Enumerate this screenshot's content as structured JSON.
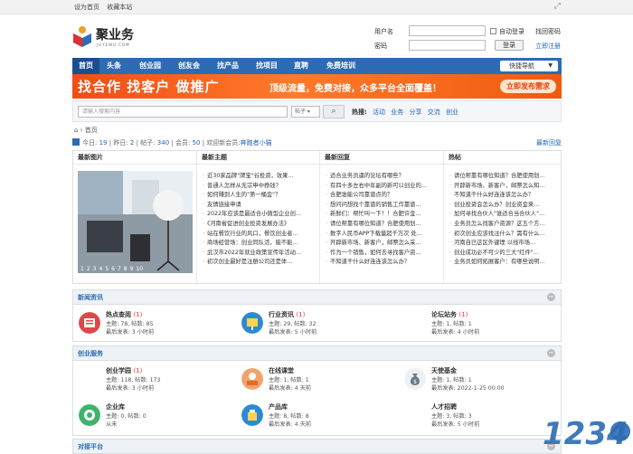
{
  "topbar": {
    "set_home": "设为首页",
    "bookmark": "收藏本站"
  },
  "logo": {
    "name": "聚业务",
    "sub": "JUYEWU.COM"
  },
  "login": {
    "username_label": "用户名",
    "password_label": "密码",
    "auto_login": "自动登录",
    "forgot": "找回密码",
    "login_button": "登录",
    "register": "立即注册"
  },
  "nav": {
    "items": [
      "首页",
      "头条",
      "创业园",
      "创友会",
      "找产品",
      "找项目",
      "直聘",
      "免费培训"
    ],
    "quick": "快捷导航"
  },
  "banner": {
    "headline": "找合作 找客户 做推广",
    "tagline": "顶级流量，免费对接，众多平台全面覆盖！",
    "cta": "立即发布需求"
  },
  "search": {
    "placeholder": "请输入搜索内容",
    "scope": "帖子",
    "hot_label": "热搜:",
    "hot": [
      "活动",
      "业务",
      "分享",
      "交流",
      "创业"
    ]
  },
  "breadcrumb": "首页",
  "stats": {
    "today_label": "今日:",
    "today": "19",
    "yesterday_label": "昨日:",
    "yesterday": "2",
    "posts_label": "帖子:",
    "posts": "340",
    "members_label": "会员:",
    "members": "50",
    "welcome": "欢迎新会员:",
    "new_member": "奔跑者小猫",
    "latest": "最新回复"
  },
  "latest_photo": {
    "title": "最新图片",
    "pages": [
      "1",
      "2",
      "3",
      "4",
      "5",
      "6",
      "7",
      "8",
      "9",
      "10"
    ]
  },
  "latest_topics": {
    "title": "最新主题",
    "items": [
      "近30家品牌\"牌宝\"谷投资，效果…",
      "普通人怎样从无宗申中挣钱？",
      "如何赚到人生的\"第一桶金\"？",
      "友情链接申请",
      "2022年应该是最适合小微型企业创…",
      "《河南省促进创业投资发展办法》",
      "站在餐饮行业的风口，餐饮创业者…",
      "商场经营场：创业同队活，能不能…",
      "武汉市2022年就业政策宣传年活动…",
      "初次创业最好是注册公司还是体…"
    ]
  },
  "latest_replies": {
    "title": "最新回复",
    "items": [
      "适合业务员逼的论坛有哪些？",
      "有四十多左右中年副的新可以创业的…",
      "合肥谁能公司靠谱点的？",
      "想问问想找个靠谱的销售工作靠谱…",
      "新鲜们：帮忙叫一下！！合肥许金…",
      "请位帮靠有哪位知道？合肥使用划…",
      "数字人民币APP下载量超千万次 处…",
      "开辟新市场、新客户，邮票怎么采…",
      "作为一个销售，如何去寻找客户资…",
      "不知道干什么好连连该怎么办？"
    ]
  },
  "hot_posts": {
    "title": "热帖",
    "items": [
      "请位帮靠有哪位知道？合肥使用划…",
      "开辟新市场、新客户，邮票怎么知…",
      "不知道干什么好连连该怎么办？",
      "创业投资会怎么办？创业资金来…",
      "加何寻找合伙人\"谁适合当合伙人\"…",
      "业务员怎么找客户资源？这五个方…",
      "初次创业应该找注什么？需有什么…",
      "河南自已这区外键理 以线市场…",
      "创业成功必不可少的三大\"红件\"…",
      "业务员如何拓展客户：有哪些说明…"
    ]
  },
  "sections": [
    {
      "title": "新闻资讯",
      "forums": [
        {
          "name": "热点查阅",
          "count": "(1)",
          "topics": "主题: 78, 帖数: 85",
          "last": "最后发表: 3 小时前"
        },
        {
          "name": "行业资讯",
          "count": "(1)",
          "topics": "主题: 29, 帖数: 32",
          "last": "最后发表: 5 小时前"
        },
        {
          "name": "论坛站务",
          "count": "(1)",
          "topics": "主题: 1, 帖数: 1",
          "last": "最后发表: 4 小时前"
        }
      ]
    },
    {
      "title": "创业服务",
      "forums": [
        {
          "name": "创业学园",
          "count": "(1)",
          "topics": "主题: 118, 帖数: 173",
          "last": "最后发表: 3 小时前"
        },
        {
          "name": "在线课堂",
          "count": "",
          "topics": "主题: 1, 帖数: 1",
          "last": "最后发表: 4 天前"
        },
        {
          "name": "天使基金",
          "count": "",
          "topics": "主题: 1, 帖数: 1",
          "last": "最后发表: 2022-1-25 00:00"
        },
        {
          "name": "企业库",
          "count": "",
          "topics": "主题: 0, 帖数: 0",
          "last": "从未"
        },
        {
          "name": "产品库",
          "count": "",
          "topics": "主题: 8, 帖数: 8",
          "last": "最后发表: 4 天前"
        },
        {
          "name": "人才招聘",
          "count": "",
          "topics": "主题: 3, 帖数: 3",
          "last": "最后发表: 5 小时前"
        }
      ]
    },
    {
      "title": "对接平台",
      "forums": []
    }
  ],
  "colors": {
    "nav": "#2b6cb4",
    "banner": "#f04d15",
    "accent": "#2266bb"
  }
}
